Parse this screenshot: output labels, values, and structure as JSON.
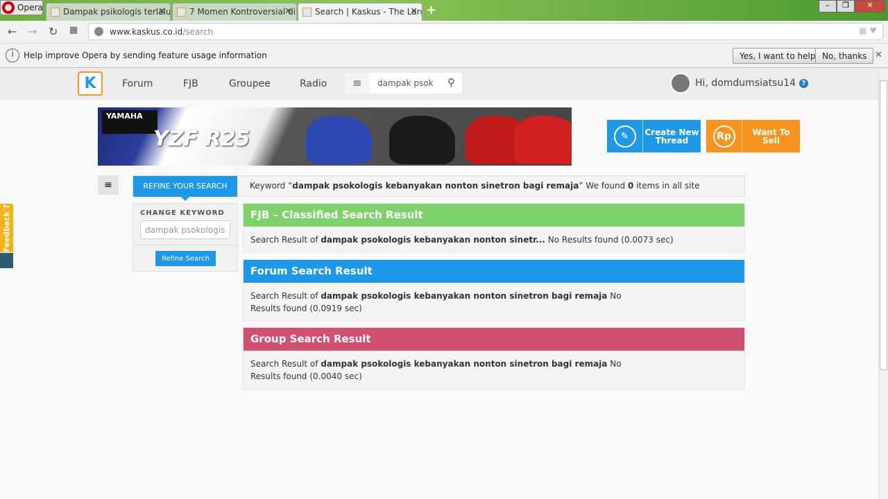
{
  "browser": {
    "opera_label": "Opera",
    "tabs": [
      {
        "title": "Dampak psikologis terlalu t"
      },
      {
        "title": "7 Momen Kontroversial di"
      },
      {
        "title": "Search | Kaskus - The Large"
      }
    ],
    "url_domain": "www.kaskus.co.id",
    "url_path": "/search",
    "infobar": {
      "text": "Help improve Opera by sending feature usage information",
      "yes": "Yes, I want to help",
      "no": "No, thanks"
    }
  },
  "header": {
    "logo": "K",
    "nav": [
      "Forum",
      "FJB",
      "Groupee",
      "Radio"
    ],
    "search_value": "dampak psok",
    "greeting": "Hi, domdumsiatsu14"
  },
  "banner": {
    "brand": "YAMAHA",
    "model": "YZF R25"
  },
  "actions": {
    "create": "Create New Thread",
    "sell": "Want To Sell",
    "sell_icon": "Rp"
  },
  "refine": {
    "tab": "REFINE YOUR SEARCH",
    "kw_prefix": "Keyword “",
    "keyword": "dampak psokologis kebanyakan nonton sinetron bagi remaja",
    "kw_mid": "” We found ",
    "count": "0",
    "kw_suffix": " items in all site"
  },
  "sidebar": {
    "heading": "CHANGE KEYWORD",
    "input_value": "dampak psokologis kebanyakan nonton sinetron bagi remaja",
    "button": "Refine Search"
  },
  "feedback": "Feedback ?",
  "results": [
    {
      "title": "FJB – Classified Search Result",
      "color": "#7dd36a",
      "prefix": "Search Result of ",
      "keyword": "dampak psokologis kebanyakan nonton sinetr...",
      "status": " No Results found (0.0073 sec)"
    },
    {
      "title": "Forum Search Result",
      "color": "#1e98e8",
      "prefix": "Search Result of ",
      "keyword": "dampak psokologis kebanyakan nonton sinetron bagi remaja",
      "status": " No Results found (0.0919 sec)"
    },
    {
      "title": "Group Search Result",
      "color": "#d0506f",
      "prefix": "Search Result of ",
      "keyword": "dampak psokologis kebanyakan nonton sinetron bagi remaja",
      "status": " No Results found (0.0040 sec)"
    }
  ]
}
